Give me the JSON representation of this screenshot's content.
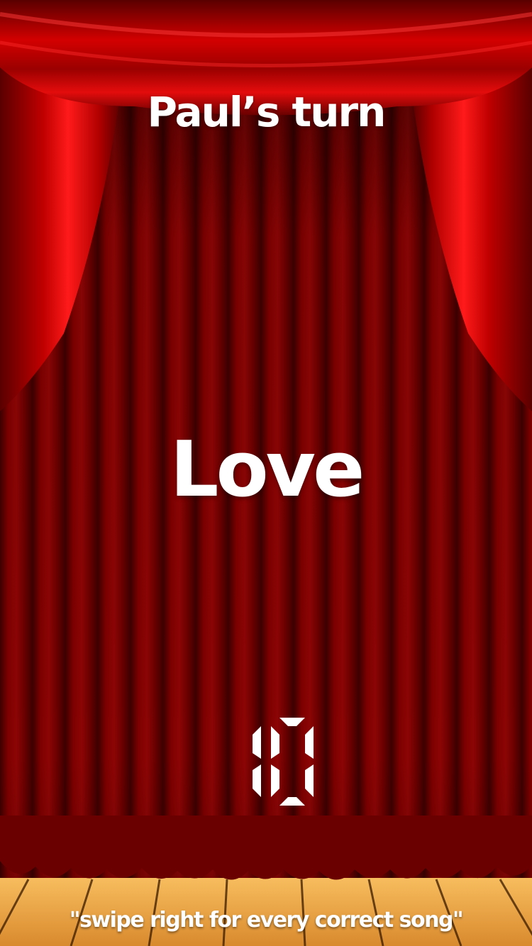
{
  "game": {
    "player_turn": "Paul’s turn",
    "prompt_word": "Love",
    "countdown": "10",
    "instruction": "\"swipe right for every correct song\""
  },
  "theme": {
    "curtain_red": "#7a0000",
    "curtain_highlight": "#e00000",
    "stage_floor": "#e9a34a",
    "text_color": "#ffffff"
  }
}
